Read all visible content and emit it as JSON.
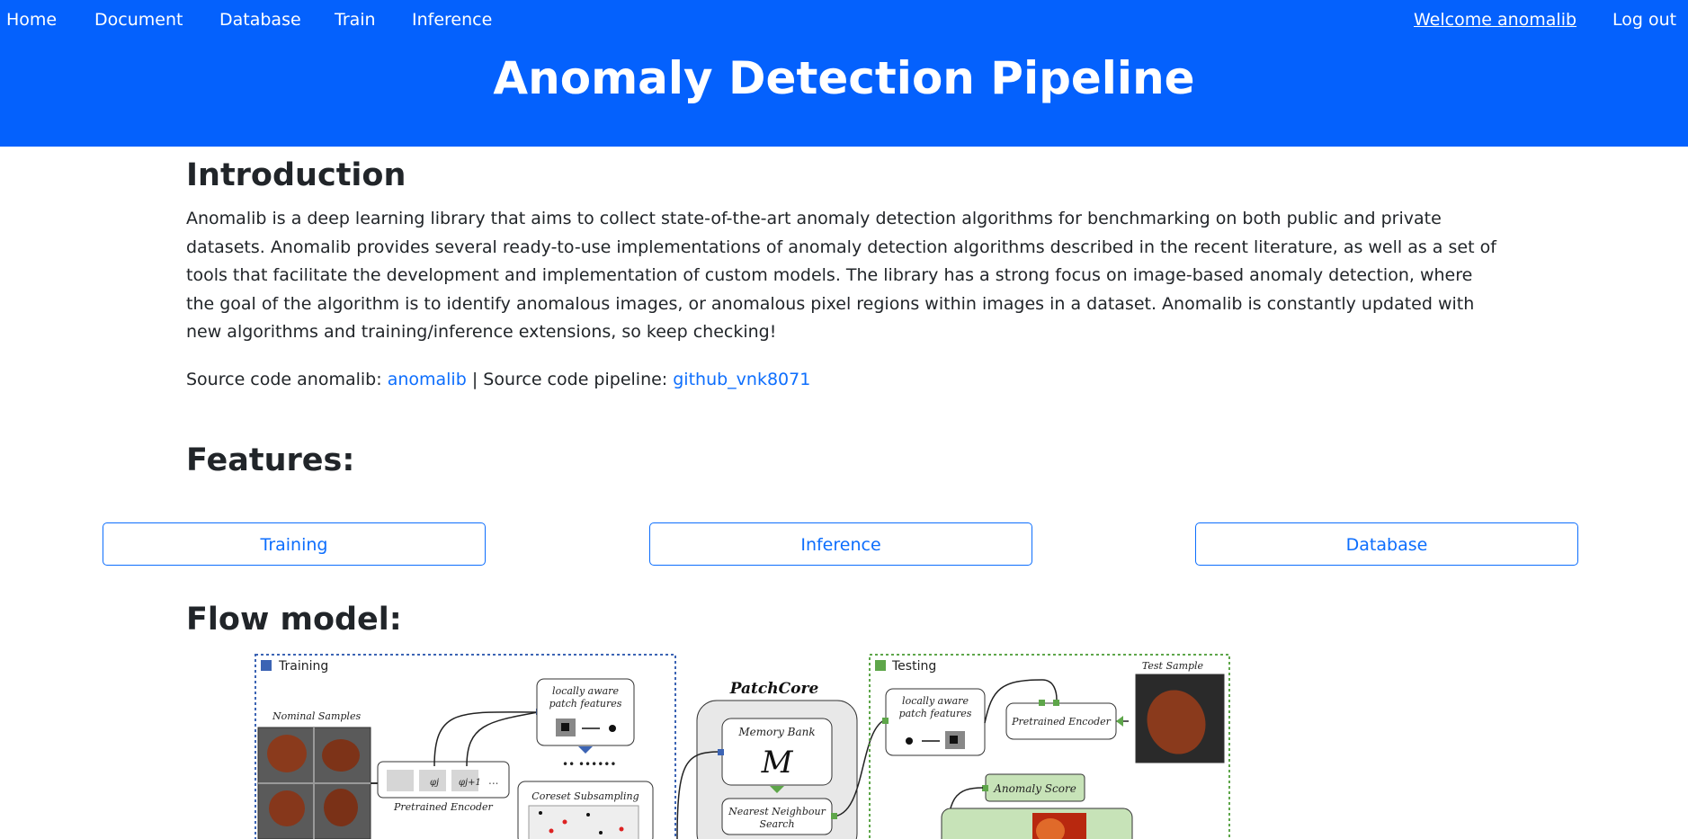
{
  "nav": {
    "left": [
      "Home",
      "Document",
      "Database",
      "Train",
      "Inference"
    ],
    "welcome": "Welcome anomalib",
    "logout": "Log out"
  },
  "header": {
    "title": "Anomaly Detection Pipeline"
  },
  "intro": {
    "heading": "Introduction",
    "paragraph": "Anomalib is a deep learning library that aims to collect state-of-the-art anomaly detection algorithms for benchmarking on both public and private datasets. Anomalib provides several ready-to-use implementations of anomaly detection algorithms described in the recent literature, as well as a set of tools that facilitate the development and implementation of custom models. The library has a strong focus on image-based anomaly detection, where the goal of the algorithm is to identify anomalous images, or anomalous pixel regions within images in a dataset. Anomalib is constantly updated with new algorithms and training/inference extensions, so keep checking!",
    "source_prefix": "Source code anomalib: ",
    "source_link": "anomalib",
    "source_mid": " | Source code pipeline: ",
    "pipeline_link": "github_vnk8071"
  },
  "features": {
    "heading": "Features:",
    "buttons": [
      "Training",
      "Inference",
      "Database"
    ]
  },
  "flow": {
    "heading": "Flow model:",
    "diagram": {
      "training_label": "Training",
      "testing_label": "Testing",
      "nominal_samples": "Nominal Samples",
      "pretrained_encoder": "Pretrained Encoder",
      "locally_aware_1": "locally aware",
      "locally_aware_2": "patch features",
      "coreset": "Coreset Subsampling",
      "patchcore": "PatchCore",
      "memory_bank": "Memory Bank",
      "memory_symbol": "M",
      "nn_search_1": "Nearest Neighbour",
      "nn_search_2": "Search",
      "test_sample": "Test Sample",
      "anomaly_score": "Anomaly Score",
      "phi_j": "φj",
      "phi_j1": "φj+1",
      "ellipsis": "..."
    }
  },
  "colors": {
    "header_bg": "#0461fd",
    "link": "#0d6efd",
    "training_border": "#3c64b4",
    "testing_border": "#5ea64a"
  }
}
